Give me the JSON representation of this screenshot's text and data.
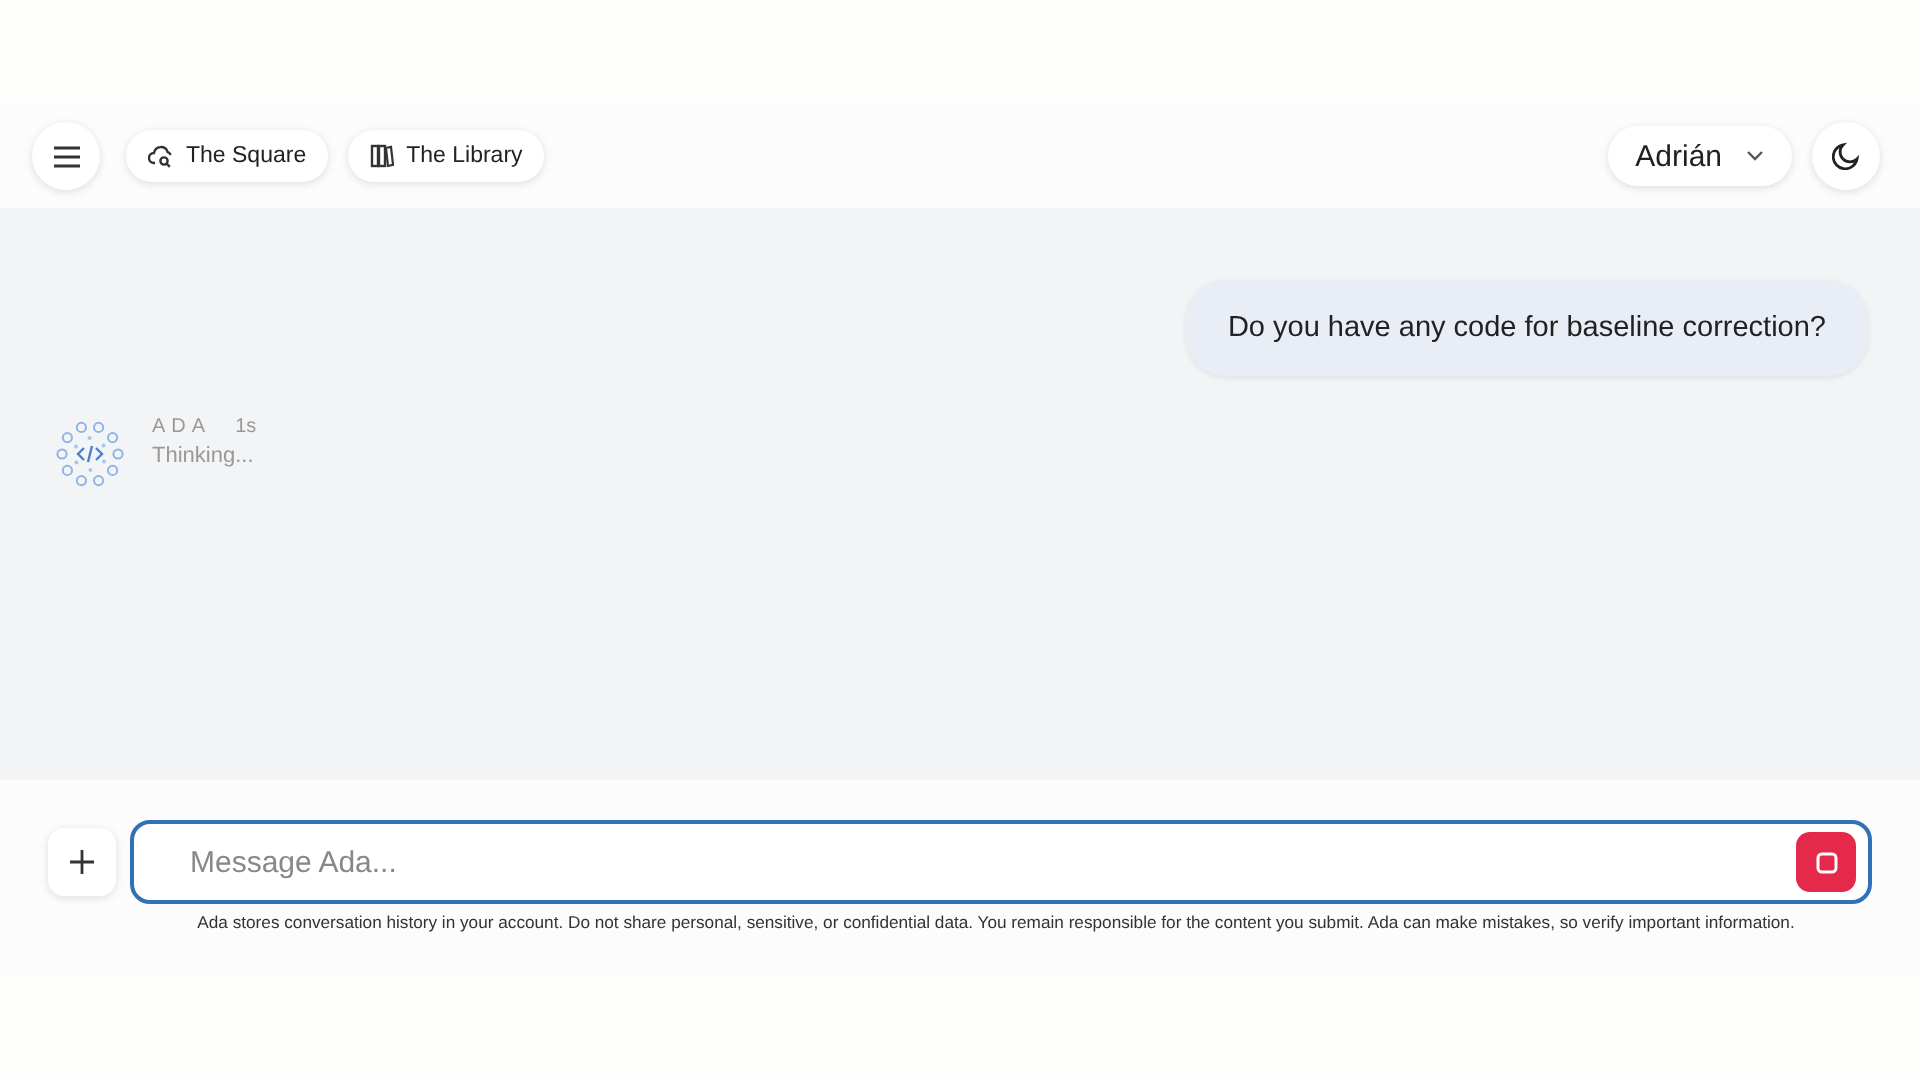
{
  "header": {
    "nav": [
      {
        "label": "The Square",
        "kind": "square"
      },
      {
        "label": "The Library",
        "kind": "library"
      }
    ],
    "user": "Adrián"
  },
  "messages": [
    {
      "kind": "user",
      "text": "Do you have any code for baseline correction?"
    },
    {
      "kind": "assistant",
      "author": "ADA",
      "time": "1s",
      "text": "Thinking..."
    }
  ],
  "composer": {
    "placeholder": "Message Ada...",
    "disclaimer": "Ada stores conversation history in your account. Do not share personal, sensitive, or confidential data. You remain responsible for the content you submit. Ada can make mistakes, so verify important information."
  }
}
